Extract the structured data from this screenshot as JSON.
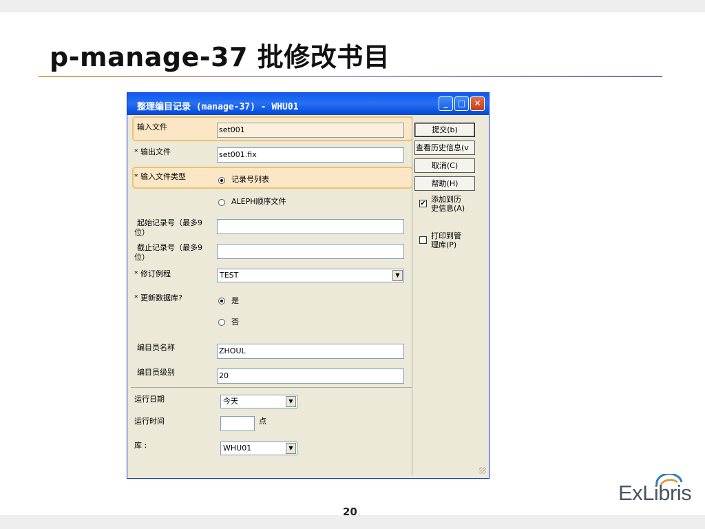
{
  "slide": {
    "title": "p-manage-37 批修改书目",
    "page_number": "20",
    "logo": "ExLibris"
  },
  "window": {
    "title": "整理编目记录 (manage-37) - WHU01",
    "controls": [
      "minimize-icon",
      "maximize-icon",
      "close-icon"
    ]
  },
  "form": {
    "input_file": {
      "label": "输入文件",
      "value": "set001"
    },
    "output_file": {
      "label": "* 输出文件",
      "value": "set001.fix"
    },
    "input_file_type": {
      "label": "* 输入文件类型",
      "options": [
        {
          "label": "记录号列表",
          "selected": true
        },
        {
          "label": "ALEPH顺序文件",
          "selected": false
        }
      ]
    },
    "start_record": {
      "label_line1": "起始记录号（最多9",
      "label_line2": "位）",
      "value": ""
    },
    "end_record": {
      "label_line1": "截止记录号（最多9",
      "label_line2": "位）",
      "value": ""
    },
    "fix_routine": {
      "label": "* 修订例程",
      "value": "TEST"
    },
    "update_db": {
      "label": "* 更新数据库?",
      "options": [
        {
          "label": "是",
          "selected": true
        },
        {
          "label": "否",
          "selected": false
        }
      ]
    },
    "cataloger_name": {
      "label": "编目员名称",
      "value": "ZHOUL"
    },
    "cataloger_level": {
      "label": "编目员级别",
      "value": "20"
    },
    "run_date": {
      "label": "运行日期",
      "value": "今天"
    },
    "run_time": {
      "label": "运行时间",
      "value": "",
      "unit": "点"
    },
    "library": {
      "label": "库 :",
      "value": "WHU01"
    }
  },
  "sidebar": {
    "submit": "提交(b)",
    "history": "查看历史信息(v",
    "cancel": "取消(C)",
    "help": "帮助(H)",
    "add_history": {
      "line1": "添加到历",
      "line2": "史信息(A)",
      "checked": true
    },
    "print_mgr": {
      "line1": "打印到管",
      "line2": "理库(P)",
      "checked": false
    }
  }
}
